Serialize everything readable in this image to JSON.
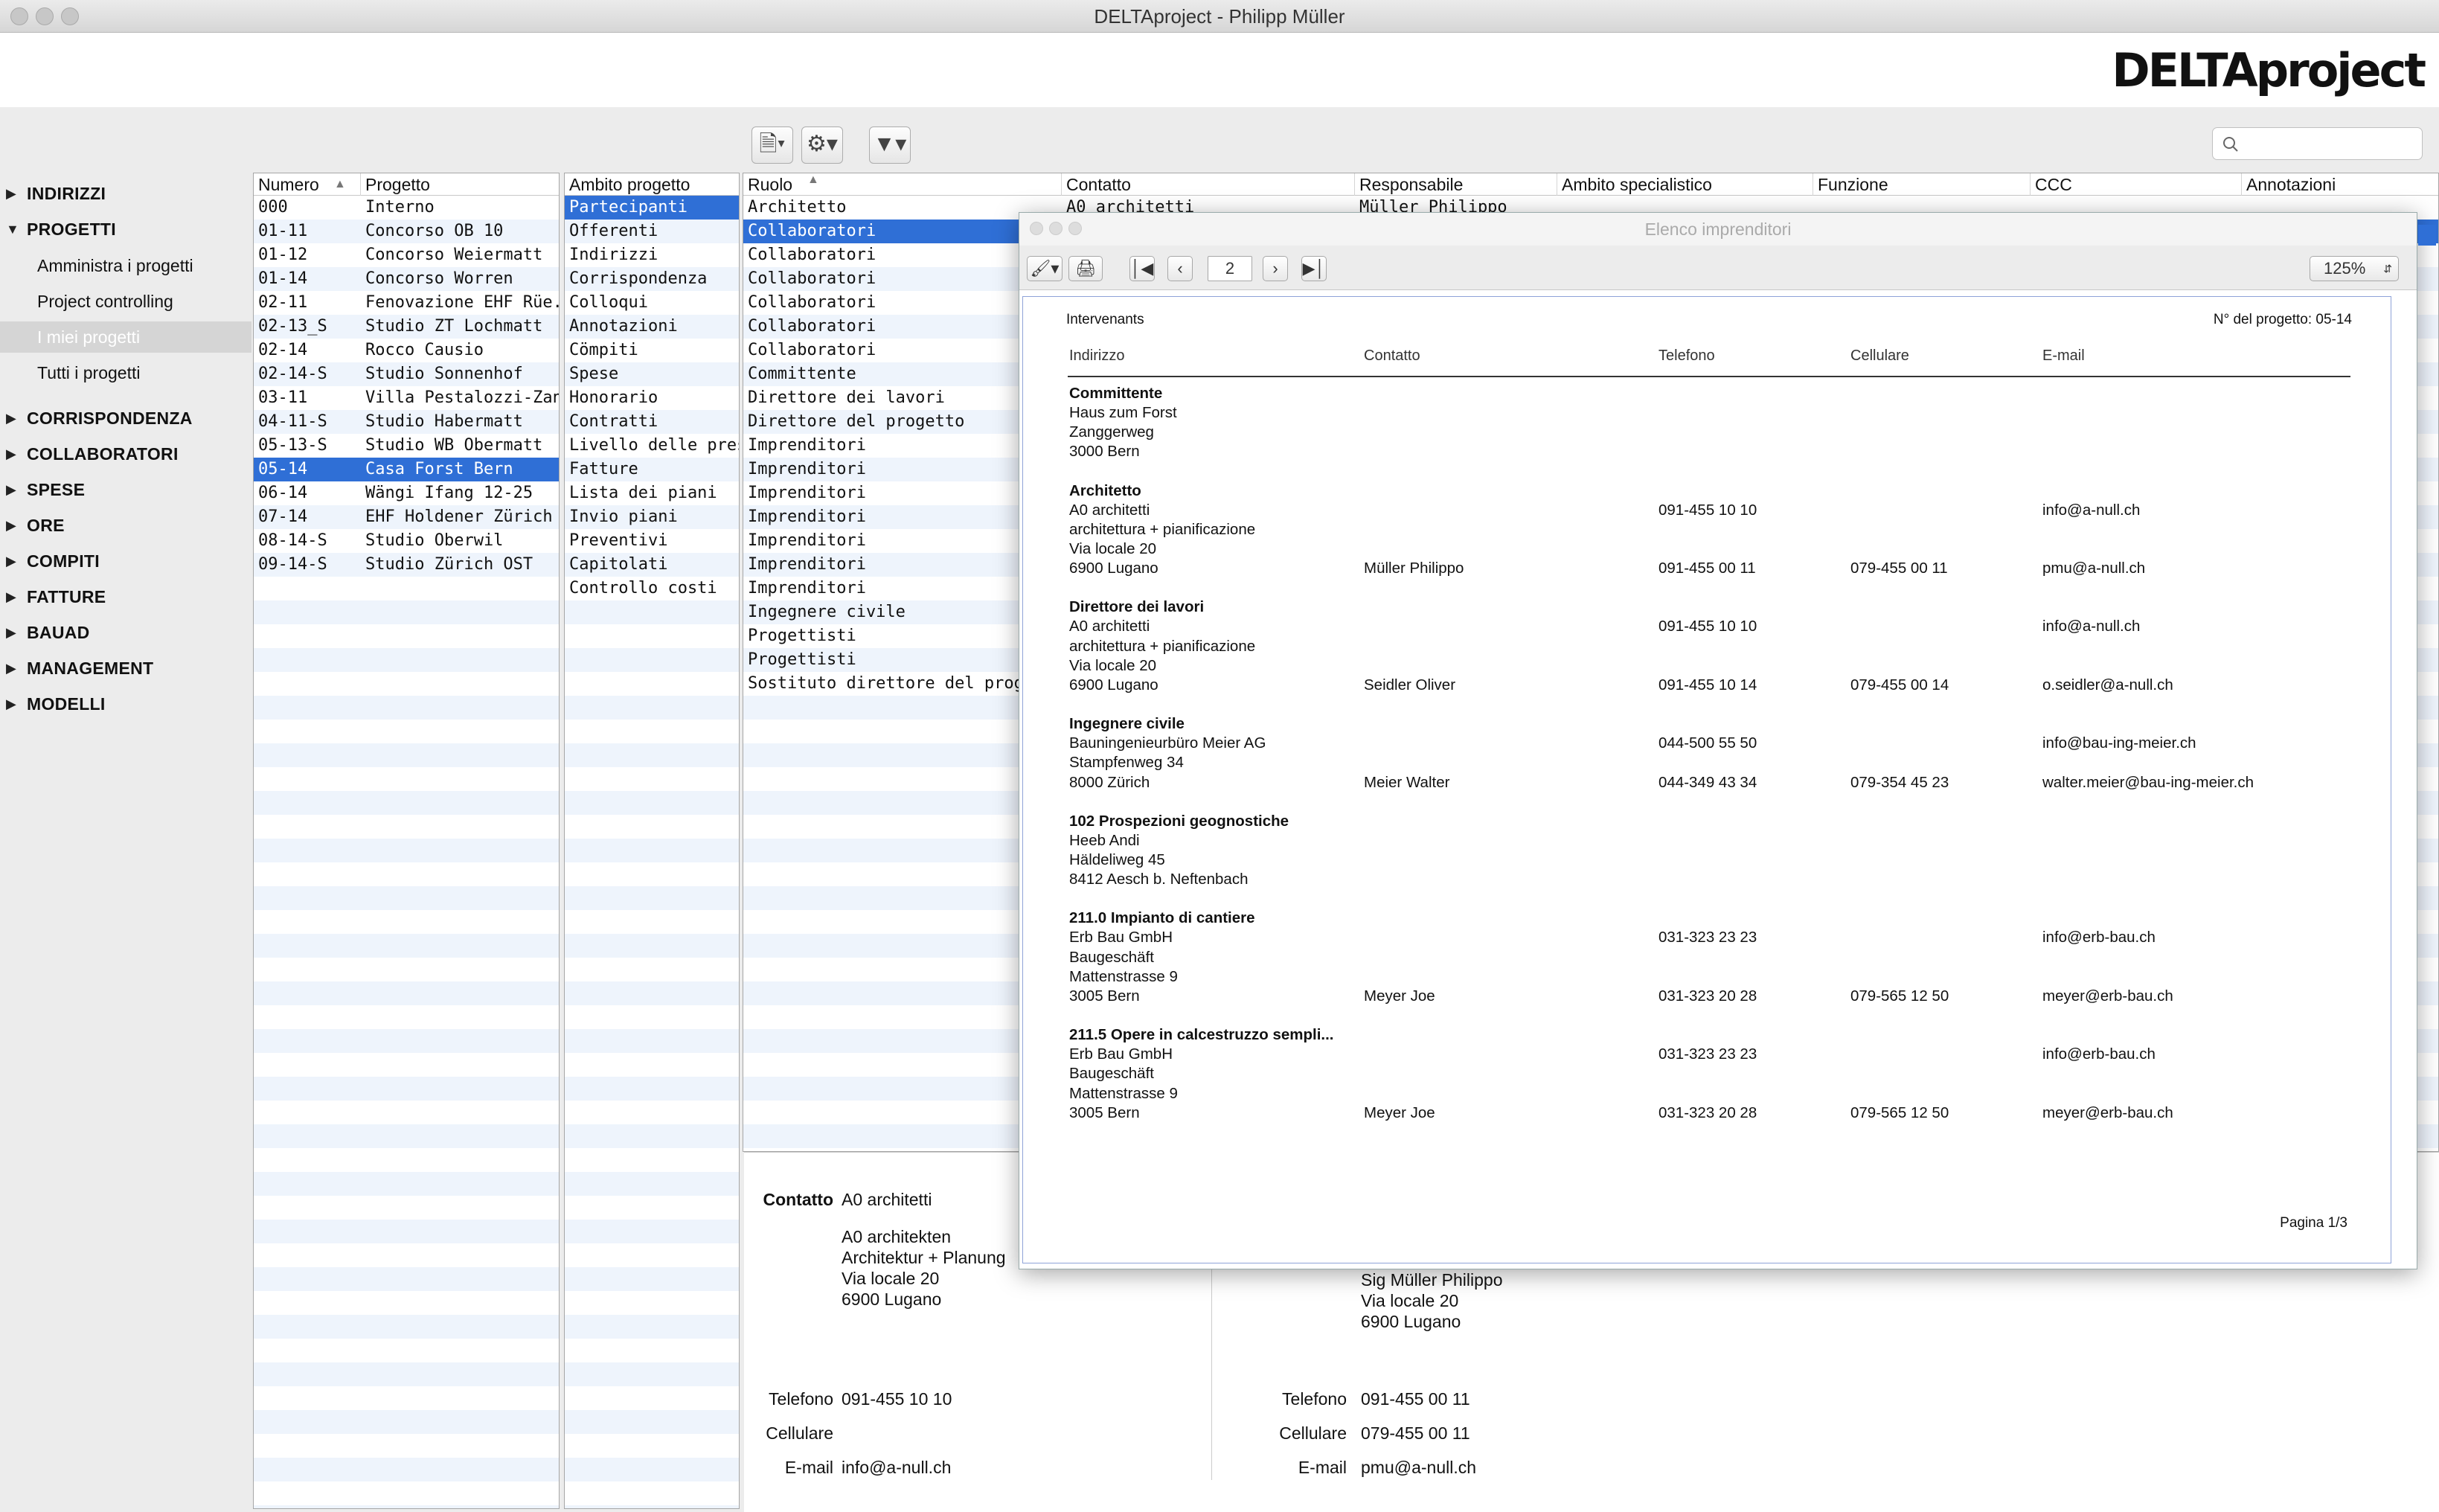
{
  "app": {
    "title": "DELTAproject - Philipp Müller",
    "logo": "DELTAproject"
  },
  "toolbar": {
    "doc_icon": "document-icon",
    "gear_icon": "gear-icon",
    "filter_icon": "filter-icon",
    "search_placeholder": ""
  },
  "nav": {
    "sections": [
      {
        "label": "INDIRIZZI",
        "expanded": false
      },
      {
        "label": "PROGETTI",
        "expanded": true
      },
      {
        "label": "CORRISPONDENZA",
        "expanded": false
      },
      {
        "label": "COLLABORATORI",
        "expanded": false
      },
      {
        "label": "SPESE",
        "expanded": false
      },
      {
        "label": "ORE",
        "expanded": false
      },
      {
        "label": "COMPITI",
        "expanded": false
      },
      {
        "label": "FATTURE",
        "expanded": false
      },
      {
        "label": "BAUAD",
        "expanded": false
      },
      {
        "label": "MANAGEMENT",
        "expanded": false
      },
      {
        "label": "MODELLI",
        "expanded": false
      }
    ],
    "progetti_items": [
      "Amministra i progetti",
      "Project controlling",
      "I miei progetti",
      "Tutti i progetti"
    ],
    "selected_item": "I miei progetti"
  },
  "projects": {
    "col_numero": "Numero",
    "col_progetto": "Progetto",
    "rows": [
      {
        "num": "000",
        "name": "Interno"
      },
      {
        "num": "01-11",
        "name": "Concorso OB 10"
      },
      {
        "num": "01-12",
        "name": "Concorso Weiermatt"
      },
      {
        "num": "01-14",
        "name": "Concorso Worren"
      },
      {
        "num": "02-11",
        "name": "Fenovazione EHF Rüe..."
      },
      {
        "num": "02-13_S",
        "name": "Studio ZT Lochmatt"
      },
      {
        "num": "02-14",
        "name": "Rocco Causio"
      },
      {
        "num": "02-14-S",
        "name": "Studio  Sonnenhof"
      },
      {
        "num": "03-11",
        "name": "Villa Pestalozzi-Zang..."
      },
      {
        "num": "04-11-S",
        "name": "Studio Habermatt"
      },
      {
        "num": "05-13-S",
        "name": "Studio WB Obermatt"
      },
      {
        "num": "05-14",
        "name": "Casa Forst Bern"
      },
      {
        "num": "06-14",
        "name": "Wängi Ifang 12-25"
      },
      {
        "num": "07-14",
        "name": "EHF Holdener Zürich"
      },
      {
        "num": "08-14-S",
        "name": "Studio Oberwil"
      },
      {
        "num": "09-14-S",
        "name": "Studio Zürich OST"
      }
    ],
    "selected_index": 11
  },
  "ambito": {
    "header": "Ambito progetto",
    "items": [
      "Partecipanti",
      "Offerenti",
      "Indirizzi",
      "Corrispondenza",
      "Colloqui",
      "Annotazioni",
      "Cömpiti",
      "Spese",
      "Honorario",
      "Contratti",
      "Livello delle presta...",
      "Fatture",
      "Lista dei piani",
      "Invio piani",
      "Preventivi",
      "Capitolati",
      "Controllo costi"
    ],
    "selected_index": 0
  },
  "roles": {
    "headers": [
      "Ruolo",
      "Contatto",
      "Responsabile",
      "Ambito specialistico",
      "Funzione",
      "CCC",
      "Annotazioni"
    ],
    "first_row": {
      "ruolo": "Architetto",
      "contatto": "A0 architetti",
      "responsabile": "Müller Philippo"
    },
    "items": [
      "Architetto",
      "Collaboratori",
      "Collaboratori",
      "Collaboratori",
      "Collaboratori",
      "Collaboratori",
      "Collaboratori",
      "Committente",
      "Direttore dei lavori",
      "Direttore del progetto",
      "Imprenditori",
      "Imprenditori",
      "Imprenditori",
      "Imprenditori",
      "Imprenditori",
      "Imprenditori",
      "Imprenditori",
      "Ingegnere civile",
      "Progettisti",
      "Progettisti",
      "Sostituto direttore del progetto"
    ],
    "selected_index": 1
  },
  "detail": {
    "left": {
      "contatto_label": "Contatto",
      "contatto": "A0 architetti",
      "address": [
        "A0 architekten",
        "Architektur + Planung",
        "Via locale 20",
        "6900 Lugano"
      ],
      "telefono_label": "Telefono",
      "telefono": "091-455 10 10",
      "cellulare_label": "Cellulare",
      "cellulare": "",
      "email_label": "E-mail",
      "email": "info@a-null.ch"
    },
    "right": {
      "address": [
        "Sig Müller Philippo",
        "Via locale 20",
        "6900 Lugano"
      ],
      "telefono_label": "Telefono",
      "telefono": "091-455 00 11",
      "cellulare_label": "Cellulare",
      "cellulare": "079-455 00 11",
      "email_label": "E-mail",
      "email": "pmu@a-null.ch"
    }
  },
  "preview": {
    "window_title": "Elenco imprenditori",
    "page_field": "2",
    "zoom": "125%",
    "report_title": "Intervenants",
    "project_no": "N° del progetto: 05-14",
    "cols": [
      "Indirizzo",
      "Contatto",
      "Telefono",
      "Cellulare",
      "E-mail"
    ],
    "footer": "Pagina  1/3",
    "groups": [
      {
        "title": "Committente",
        "lines": [
          {
            "addr": "Haus zum Forst",
            "contact": "",
            "tel": "",
            "cell": "",
            "mail": ""
          },
          {
            "addr": "Zanggerweg",
            "contact": "",
            "tel": "",
            "cell": "",
            "mail": ""
          },
          {
            "addr": "3000 Bern",
            "contact": "",
            "tel": "",
            "cell": "",
            "mail": ""
          }
        ]
      },
      {
        "title": "Architetto",
        "lines": [
          {
            "addr": "A0 architetti",
            "contact": "",
            "tel": "091-455 10 10",
            "cell": "",
            "mail": "info@a-null.ch"
          },
          {
            "addr": "architettura + pianificazione",
            "contact": "",
            "tel": "",
            "cell": "",
            "mail": ""
          },
          {
            "addr": "Via locale 20",
            "contact": "",
            "tel": "",
            "cell": "",
            "mail": ""
          },
          {
            "addr": "6900 Lugano",
            "contact": "Müller Philippo",
            "tel": "091-455 00 11",
            "cell": "079-455 00 11",
            "mail": "pmu@a-null.ch"
          }
        ]
      },
      {
        "title": "Direttore dei lavori",
        "lines": [
          {
            "addr": "A0 architetti",
            "contact": "",
            "tel": "091-455 10 10",
            "cell": "",
            "mail": "info@a-null.ch"
          },
          {
            "addr": "architettura + pianificazione",
            "contact": "",
            "tel": "",
            "cell": "",
            "mail": ""
          },
          {
            "addr": "Via locale 20",
            "contact": "",
            "tel": "",
            "cell": "",
            "mail": ""
          },
          {
            "addr": "6900 Lugano",
            "contact": "Seidler Oliver",
            "tel": "091-455 10 14",
            "cell": "079-455 00 14",
            "mail": "o.seidler@a-null.ch"
          }
        ]
      },
      {
        "title": "Ingegnere civile",
        "lines": [
          {
            "addr": "Bauningenieurbüro Meier AG",
            "contact": "",
            "tel": "044-500 55 50",
            "cell": "",
            "mail": "info@bau-ing-meier.ch"
          },
          {
            "addr": "Stampfenweg 34",
            "contact": "",
            "tel": "",
            "cell": "",
            "mail": ""
          },
          {
            "addr": "8000 Zürich",
            "contact": "Meier Walter",
            "tel": "044-349 43 34",
            "cell": "079-354 45 23",
            "mail": "walter.meier@bau-ing-meier.ch"
          }
        ]
      },
      {
        "title": "102 Prospezioni geognostiche",
        "lines": [
          {
            "addr": "Heeb Andi",
            "contact": "",
            "tel": "",
            "cell": "",
            "mail": ""
          },
          {
            "addr": "Häldeliweg 45",
            "contact": "",
            "tel": "",
            "cell": "",
            "mail": ""
          },
          {
            "addr": "8412 Aesch b. Neftenbach",
            "contact": "",
            "tel": "",
            "cell": "",
            "mail": ""
          }
        ]
      },
      {
        "title": "211.0 Impianto di cantiere",
        "lines": [
          {
            "addr": "Erb Bau GmbH",
            "contact": "",
            "tel": "031-323 23 23",
            "cell": "",
            "mail": "info@erb-bau.ch"
          },
          {
            "addr": "Baugeschäft",
            "contact": "",
            "tel": "",
            "cell": "",
            "mail": ""
          },
          {
            "addr": "Mattenstrasse 9",
            "contact": "",
            "tel": "",
            "cell": "",
            "mail": ""
          },
          {
            "addr": "3005 Bern",
            "contact": "Meyer Joe",
            "tel": "031-323 20 28",
            "cell": "079-565 12 50",
            "mail": "meyer@erb-bau.ch"
          }
        ]
      },
      {
        "title": "211.5 Opere in calcestruzzo sempli...",
        "lines": [
          {
            "addr": "Erb Bau GmbH",
            "contact": "",
            "tel": "031-323 23 23",
            "cell": "",
            "mail": "info@erb-bau.ch"
          },
          {
            "addr": "Baugeschäft",
            "contact": "",
            "tel": "",
            "cell": "",
            "mail": ""
          },
          {
            "addr": "Mattenstrasse 9",
            "contact": "",
            "tel": "",
            "cell": "",
            "mail": ""
          },
          {
            "addr": "3005 Bern",
            "contact": "Meyer Joe",
            "tel": "031-323 20 28",
            "cell": "079-565 12 50",
            "mail": "meyer@erb-bau.ch"
          }
        ]
      }
    ]
  }
}
